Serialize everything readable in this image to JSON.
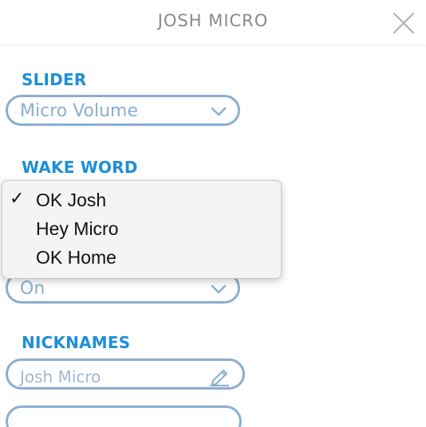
{
  "header": {
    "title": "JOSH MICRO",
    "close_icon": "close-icon"
  },
  "slider": {
    "label": "SLIDER",
    "selected": "Micro Volume"
  },
  "wake_word": {
    "label": "WAKE WORD",
    "options": [
      "OK Josh",
      "Hey Micro",
      "OK Home"
    ],
    "selected": "OK Josh",
    "check": "✓"
  },
  "hidden_toggle": {
    "selected": "On"
  },
  "nicknames": {
    "label": "NICKNAMES",
    "first_value": "Josh Micro",
    "edit_icon": "pencil-icon"
  },
  "colors": {
    "accent": "#1d8fd7",
    "pill_border": "#8aaed1",
    "header_text": "#8a8a8a"
  }
}
